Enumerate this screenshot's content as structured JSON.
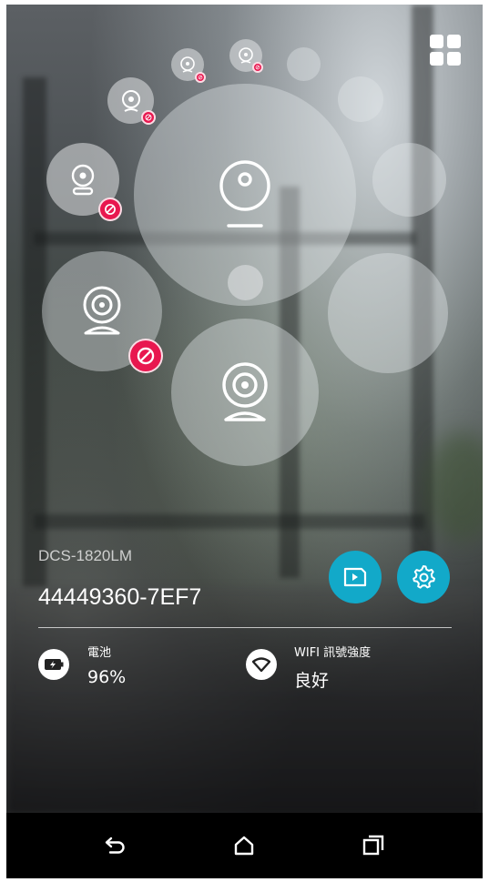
{
  "device": {
    "model": "DCS-1820LM",
    "id": "44449360-7EF7"
  },
  "stats": {
    "battery_label": "電池",
    "battery_value": "96%",
    "wifi_label": "WIFI 訊號強度",
    "wifi_value": "良好"
  },
  "icons": {
    "grid": "grid-view-icon",
    "playback": "playback-icon",
    "settings": "settings-gear-icon",
    "battery": "battery-charging-icon",
    "wifi": "wifi-icon",
    "camera": "camera-icon",
    "disabled": "disabled-badge-icon",
    "nav_back": "back-icon",
    "nav_home": "home-icon",
    "nav_recents": "recents-icon"
  },
  "colors": {
    "accent": "#12a9c9",
    "disabled_badge": "#e8174f",
    "navbar": "#000000"
  }
}
